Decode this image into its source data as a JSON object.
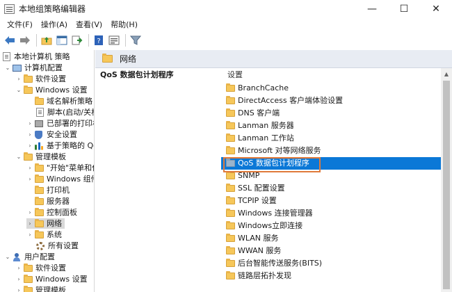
{
  "window": {
    "title": "本地组策略编辑器",
    "minimize": "—",
    "maximize": "☐",
    "close": "✕"
  },
  "menu": [
    "文件(F)",
    "操作(A)",
    "查看(V)",
    "帮助(H)"
  ],
  "toolbar_icons": [
    "back-icon",
    "forward-icon",
    "up-folder-icon",
    "show-hide-tree-icon",
    "export-list-icon",
    "help-icon",
    "properties-icon",
    "filter-icon"
  ],
  "tree": [
    {
      "label": "本地计算机 策略",
      "icon": "document-icon"
    },
    {
      "label": "计算机配置",
      "icon": "computer-icon",
      "twisty": "⌄"
    },
    {
      "label": "软件设置",
      "icon": "folder-icon",
      "twisty": "›"
    },
    {
      "label": "Windows 设置",
      "icon": "folder-icon",
      "twisty": "⌄"
    },
    {
      "label": "域名解析策略",
      "icon": "folder-icon"
    },
    {
      "label": "脚本(启动/关机)",
      "icon": "document-icon"
    },
    {
      "label": "已部署的打印机",
      "icon": "printer-icon",
      "twisty": "›"
    },
    {
      "label": "安全设置",
      "icon": "shield-icon",
      "twisty": "›"
    },
    {
      "label": "基于策略的 QoS",
      "icon": "chart-icon",
      "twisty": "›"
    },
    {
      "label": "管理模板",
      "icon": "folder-icon",
      "twisty": "⌄"
    },
    {
      "label": "\"开始\"菜单和任务栏",
      "icon": "folder-icon",
      "twisty": "›"
    },
    {
      "label": "Windows 组件",
      "icon": "folder-icon",
      "twisty": "›"
    },
    {
      "label": "打印机",
      "icon": "folder-icon"
    },
    {
      "label": "服务器",
      "icon": "folder-icon"
    },
    {
      "label": "控制面板",
      "icon": "folder-icon",
      "twisty": "›"
    },
    {
      "label": "网络",
      "icon": "folder-icon",
      "twisty": "›",
      "selected": true
    },
    {
      "label": "系统",
      "icon": "folder-icon",
      "twisty": "›"
    },
    {
      "label": "所有设置",
      "icon": "settings-icon"
    },
    {
      "label": "用户配置",
      "icon": "user-icon",
      "twisty": "⌄"
    },
    {
      "label": "软件设置",
      "icon": "folder-icon",
      "twisty": "›"
    },
    {
      "label": "Windows 设置",
      "icon": "folder-icon",
      "twisty": "›"
    },
    {
      "label": "管理模板",
      "icon": "folder-icon",
      "twisty": "›"
    }
  ],
  "header": {
    "title": "网络"
  },
  "middle": {
    "title": "QoS 数据包计划程序"
  },
  "list": {
    "column_header": "设置",
    "items": [
      {
        "label": "BranchCache"
      },
      {
        "label": "DirectAccess 客户端体验设置"
      },
      {
        "label": "DNS 客户端"
      },
      {
        "label": "Lanman 服务器"
      },
      {
        "label": "Lanman 工作站"
      },
      {
        "label": "Microsoft 对等网络服务"
      },
      {
        "label": "QoS 数据包计划程序",
        "selected": true
      },
      {
        "label": "SNMP"
      },
      {
        "label": "SSL 配置设置"
      },
      {
        "label": "TCPIP 设置"
      },
      {
        "label": "Windows 连接管理器"
      },
      {
        "label": "Windows立即连接"
      },
      {
        "label": "WLAN 服务"
      },
      {
        "label": "WWAN 服务"
      },
      {
        "label": "后台智能传送服务(BITS)"
      },
      {
        "label": "链路层拓扑发现"
      }
    ]
  },
  "colors": {
    "selection": "#0b78d7",
    "highlight_border": "#e07a3a",
    "header_bg": "#e8ecf3",
    "folder": "#f6c75a"
  }
}
